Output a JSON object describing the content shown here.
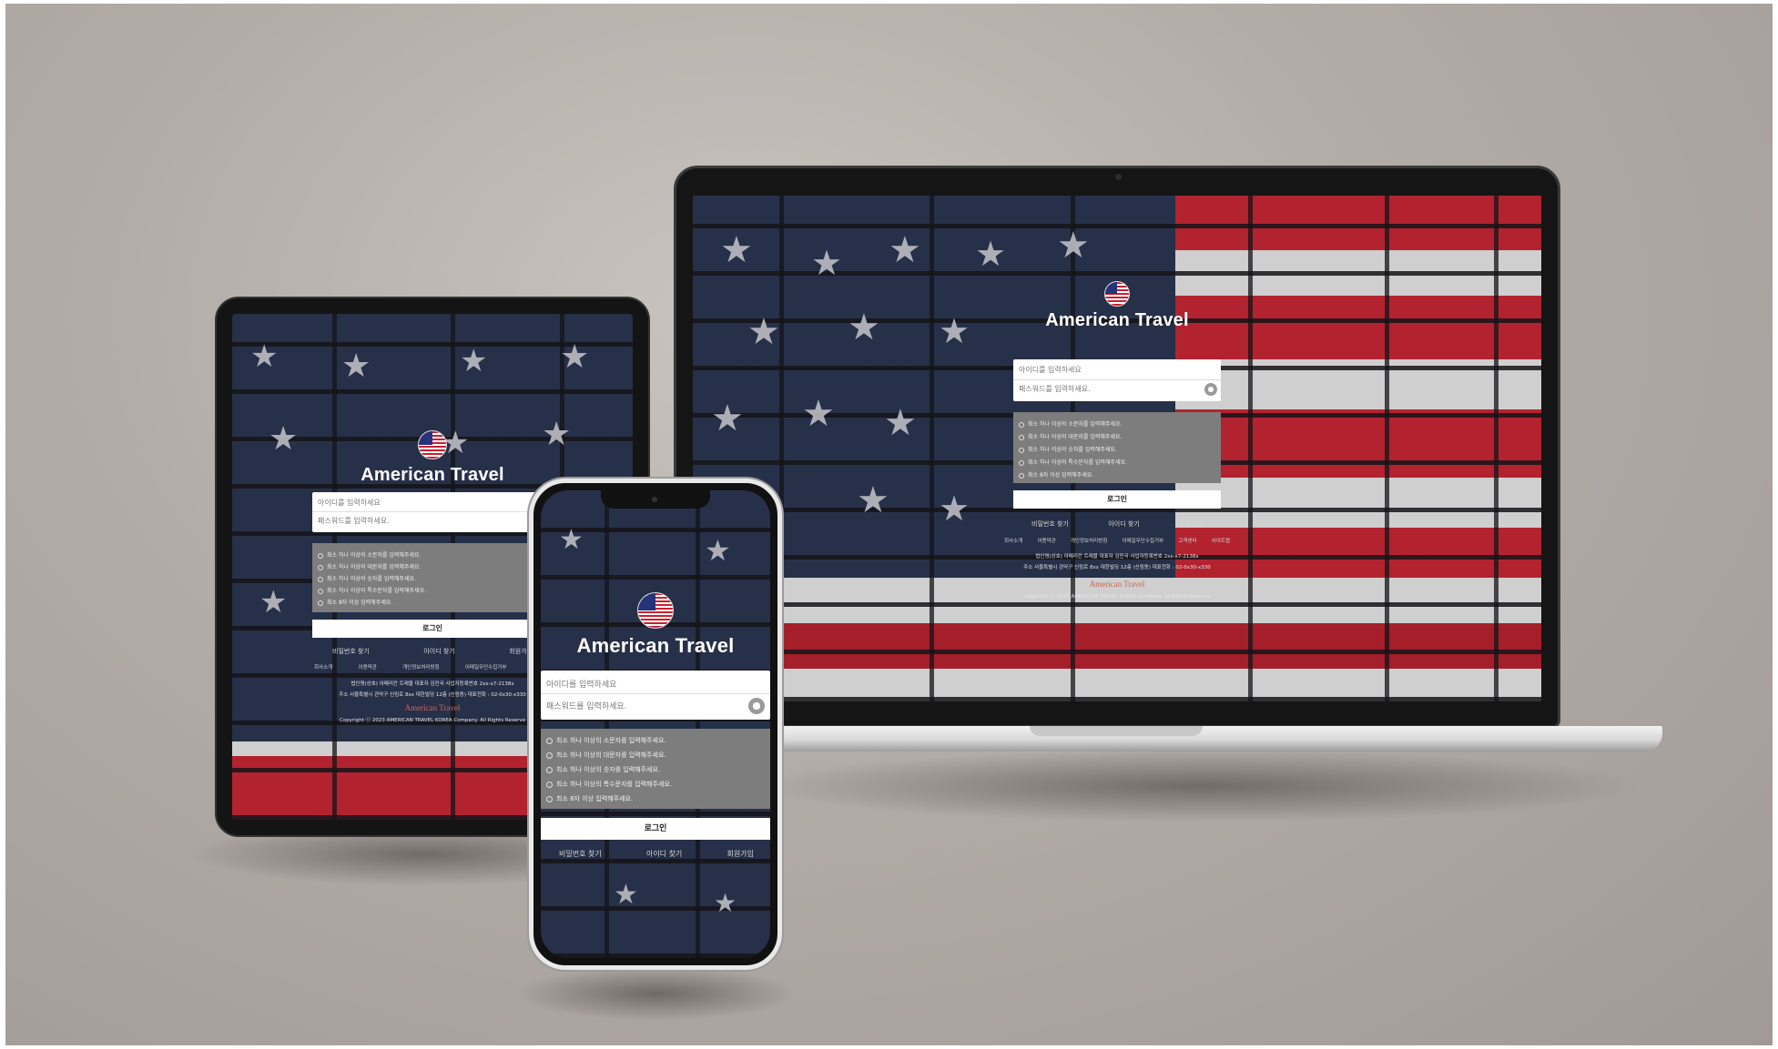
{
  "brand": "American Travel",
  "id_placeholder": "아이디를 입력하세요",
  "pw_placeholder": "패스워드를 입력하세요.",
  "rules": [
    "최소 하나 이상의 소문자를 입력해주세요.",
    "최소 하나 이상의 대문자를 입력해주세요.",
    "최소 하나 이상의 숫자를 입력해주세요.",
    "최소 하나 이상의 특수문자를 입력해주세요.",
    "최소 8자 이상 입력해주세요."
  ],
  "login_label": "로그인",
  "links": {
    "find_pw": "비밀번호 찾기",
    "find_id": "아이디 찾기",
    "signup": "회원가입"
  },
  "footer": {
    "nav": [
      "회사소개",
      "이용약관",
      "개인정보처리방침",
      "이메일무단수집거부",
      "고객센터",
      "사이트맵"
    ],
    "company_info": "법인명(상호) 아메리칸 트래블 대표자 김민국 사업자등록번호 2xx-x7-2138x",
    "address": "주소 서울특별시 관악구 신림로 8xx 대한빌딩 12층 (신림동) 대표전화 : 02-0x30-x330",
    "footer_brand": "American Travel",
    "copyright": "Copyright ⓒ 2023 AMERICAN TRAVEL KOREA Company. All Rights Reserve"
  },
  "colors": {
    "flag_blue": "#273049",
    "flag_red": "#b2232f",
    "flag_white": "#d6d6d6",
    "rules_bg": "#7d7d7d"
  }
}
